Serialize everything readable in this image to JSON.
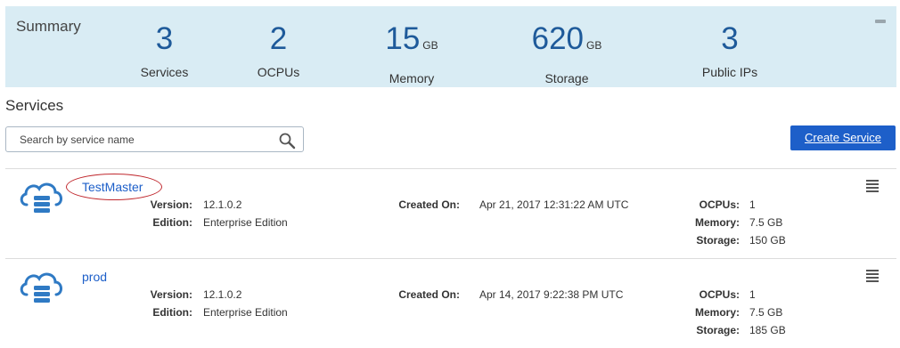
{
  "summary": {
    "title": "Summary",
    "metrics": [
      {
        "value": "3",
        "unit": "",
        "label": "Services"
      },
      {
        "value": "2",
        "unit": "",
        "label": "OCPUs"
      },
      {
        "value": "15",
        "unit": "GB",
        "label": "Memory"
      },
      {
        "value": "620",
        "unit": "GB",
        "label": "Storage"
      },
      {
        "value": "3",
        "unit": "",
        "label": "Public IPs"
      }
    ]
  },
  "services": {
    "title": "Services",
    "search_placeholder": "Search by service name",
    "create_label": "Create Service",
    "labels": {
      "version": "Version:",
      "edition": "Edition:",
      "created_on": "Created On:",
      "ocpus": "OCPUs:",
      "memory": "Memory:",
      "storage": "Storage:"
    },
    "items": [
      {
        "name": "TestMaster",
        "version": "12.1.0.2",
        "edition": "Enterprise Edition",
        "created_on": "Apr 21, 2017 12:31:22 AM UTC",
        "ocpus": "1",
        "memory": "7.5 GB",
        "storage": "150 GB"
      },
      {
        "name": "prod",
        "version": "12.1.0.2",
        "edition": "Enterprise Edition",
        "created_on": "Apr 14, 2017 9:22:38 PM UTC",
        "ocpus": "1",
        "memory": "7.5 GB",
        "storage": "185 GB"
      }
    ]
  }
}
